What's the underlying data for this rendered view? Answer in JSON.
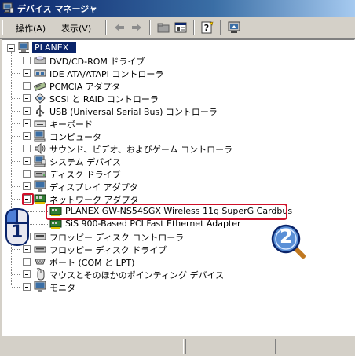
{
  "window": {
    "title": "デバイス マネージャ"
  },
  "menu": {
    "action": "操作(A)",
    "view": "表示(V)"
  },
  "toolbar": {
    "buttons": [
      "back",
      "forward",
      "up-folder",
      "properties",
      "help",
      "scan-hardware"
    ]
  },
  "tree": {
    "root": "PLANEX",
    "items": [
      {
        "label": "DVD/CD-ROM ドライブ",
        "icon": "cdrom-icon",
        "expanded": false
      },
      {
        "label": "IDE ATA/ATAPI コントローラ",
        "icon": "ide-controller-icon",
        "expanded": false
      },
      {
        "label": "PCMCIA アダプタ",
        "icon": "pcmcia-icon",
        "expanded": false
      },
      {
        "label": "SCSI と RAID コントローラ",
        "icon": "scsi-icon",
        "expanded": false
      },
      {
        "label": "USB (Universal Serial Bus) コントローラ",
        "icon": "usb-icon",
        "expanded": false
      },
      {
        "label": "キーボード",
        "icon": "keyboard-icon",
        "expanded": false
      },
      {
        "label": "コンピュータ",
        "icon": "computer-icon",
        "expanded": false
      },
      {
        "label": "サウンド、ビデオ、およびゲーム コントローラ",
        "icon": "sound-icon",
        "expanded": false
      },
      {
        "label": "システム デバイス",
        "icon": "system-device-icon",
        "expanded": false
      },
      {
        "label": "ディスク ドライブ",
        "icon": "disk-drive-icon",
        "expanded": false
      },
      {
        "label": "ディスプレイ アダプタ",
        "icon": "display-icon",
        "expanded": false
      },
      {
        "label": "ネットワーク アダプタ",
        "icon": "network-adapter-icon",
        "expanded": true,
        "children": [
          "PLANEX GW-NS54SGX Wireless 11g SuperG Cardbus",
          "SiS 900-Based PCI Fast Ethernet Adapter"
        ]
      },
      {
        "label": "フロッピー ディスク コントローラ",
        "icon": "floppy-controller-icon",
        "expanded": false
      },
      {
        "label": "フロッピー ディスク ドライブ",
        "icon": "floppy-drive-icon",
        "expanded": false
      },
      {
        "label": "ポート (COM と LPT)",
        "icon": "port-icon",
        "expanded": false
      },
      {
        "label": "マウスとそのほかのポインティング デバイス",
        "icon": "mouse-icon",
        "expanded": false
      },
      {
        "label": "モニタ",
        "icon": "monitor-icon",
        "expanded": false
      }
    ]
  },
  "annotations": {
    "step1": "1",
    "step2": "2"
  },
  "colors": {
    "highlight": "#d0102a",
    "selection": "#0a246a",
    "titlebar": "#0a246a",
    "step2_fill": "#5a8fd6"
  }
}
